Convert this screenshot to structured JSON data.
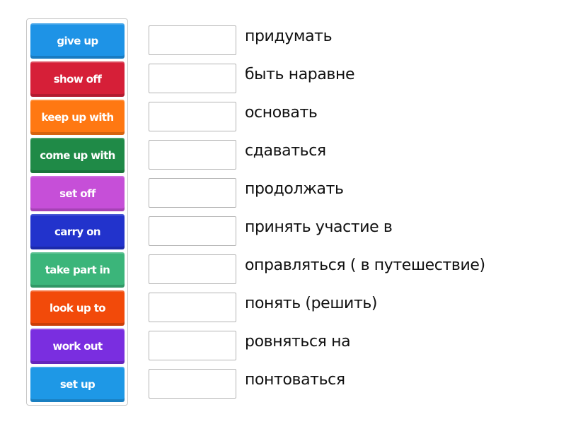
{
  "activity": {
    "type": "match-up",
    "tiles": [
      {
        "label": "give up",
        "color": "#1e93e6"
      },
      {
        "label": "show off",
        "color": "#d61f38"
      },
      {
        "label": "keep up with",
        "color": "#ff7812"
      },
      {
        "label": "come up with",
        "color": "#1f8a47"
      },
      {
        "label": "set off",
        "color": "#c64fd8"
      },
      {
        "label": "carry on",
        "color": "#2233cc"
      },
      {
        "label": "take part in",
        "color": "#3bb57a"
      },
      {
        "label": "look up to",
        "color": "#f24a0a"
      },
      {
        "label": "work out",
        "color": "#7a2ee0"
      },
      {
        "label": "set up",
        "color": "#1e98e6"
      }
    ],
    "definitions": [
      {
        "text": "придумать",
        "answer": ""
      },
      {
        "text": "быть наравне",
        "answer": ""
      },
      {
        "text": "основать",
        "answer": ""
      },
      {
        "text": "сдаваться",
        "answer": ""
      },
      {
        "text": "продолжать",
        "answer": ""
      },
      {
        "text": "принять участие в",
        "answer": ""
      },
      {
        "text": "оправляться ( в путешествие)",
        "answer": ""
      },
      {
        "text": "понять (решить)",
        "answer": ""
      },
      {
        "text": "ровняться на",
        "answer": ""
      },
      {
        "text": "понтоваться",
        "answer": ""
      }
    ]
  }
}
